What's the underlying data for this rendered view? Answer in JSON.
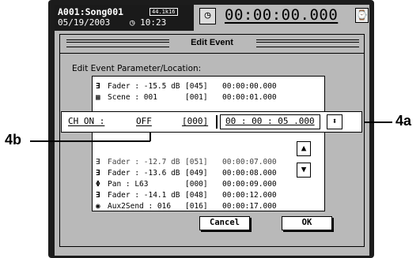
{
  "header": {
    "song": "A001:Song001",
    "format_badge": "44.1k16",
    "date": "05/19/2003",
    "clock_glyph": "◷",
    "time": "10:23",
    "counter": "00:00:00.000",
    "clock_button_glyph": "◷",
    "counter_icon_glyph": "⌚"
  },
  "dialog": {
    "title": "Edit Event",
    "param_label": "Edit Event Parameter/Location:",
    "events_top": [
      {
        "icon": "fader-icon",
        "glyph": "∃",
        "name": "Fader : -15.5 dB",
        "idx": "[045]",
        "time": "00:00:00.000"
      },
      {
        "icon": "scene-icon",
        "glyph": "▦",
        "name": "Scene : 001",
        "idx": "[001]",
        "time": "00:00:01.000"
      }
    ],
    "events_bottom": [
      {
        "icon": "fader-icon",
        "glyph": "∃",
        "name": "Fader : -12.7 dB",
        "idx": "[051]",
        "time": "00:00:07.000",
        "partial": true
      },
      {
        "icon": "fader-icon",
        "glyph": "∃",
        "name": "Fader : -13.6 dB",
        "idx": "[049]",
        "time": "00:00:08.000"
      },
      {
        "icon": "pan-icon",
        "glyph": "Φ",
        "name": "Pan : L63",
        "idx": "[000]",
        "time": "00:00:09.000"
      },
      {
        "icon": "fader-icon",
        "glyph": "∃",
        "name": "Fader : -14.1 dB",
        "idx": "[048]",
        "time": "00:00:12.000"
      },
      {
        "icon": "aux-send-icon",
        "glyph": "◉",
        "name": "Aux2Send : 016",
        "idx": "[016]",
        "time": "00:00:17.000"
      }
    ],
    "edit_row": {
      "param": "CH_ON :",
      "value": "OFF",
      "index": "[000]",
      "time": "00 : 00 : 05 .000",
      "spin_glyph": "⬍"
    },
    "scroll_up_glyph": "▲",
    "scroll_down_glyph": "▼",
    "cancel_label": "Cancel",
    "ok_label": "OK"
  },
  "callouts": {
    "a": "4a",
    "b": "4b"
  }
}
